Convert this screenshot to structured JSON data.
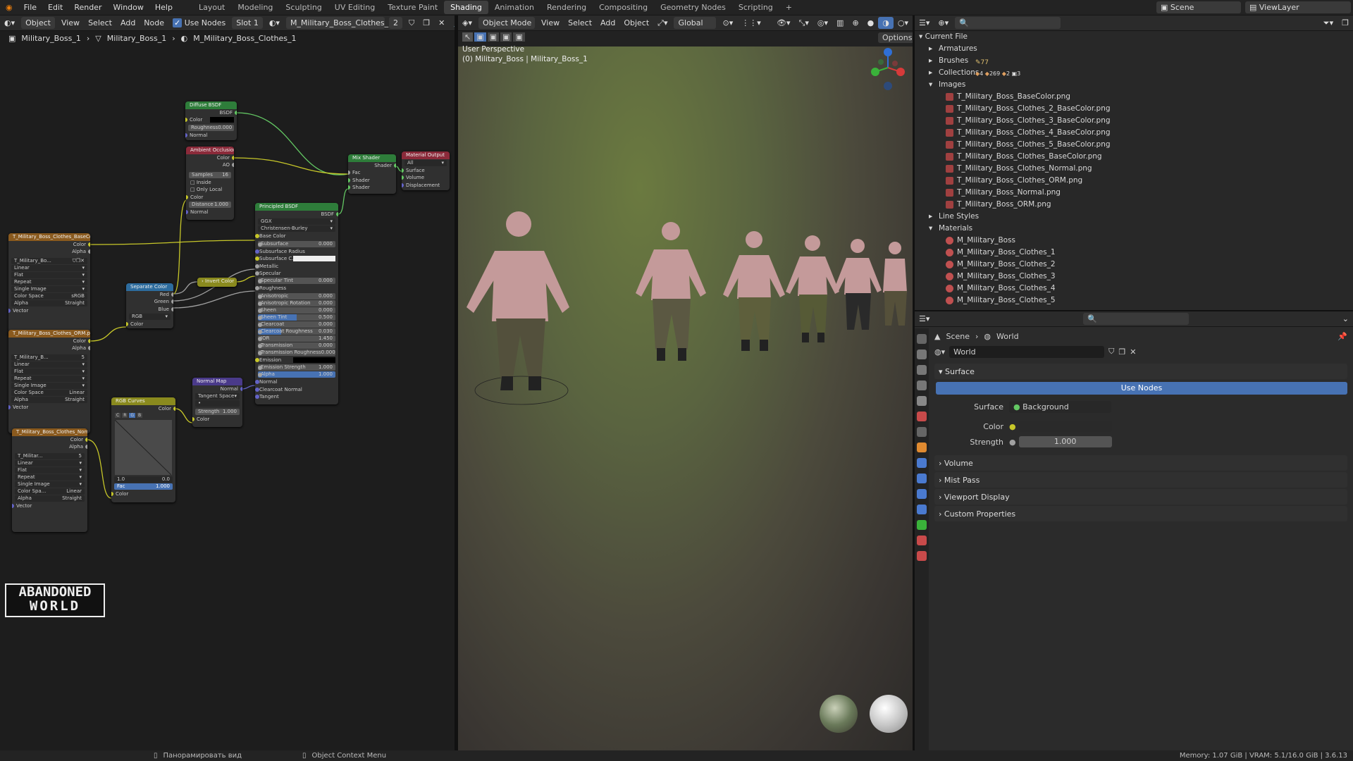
{
  "menu": {
    "items": [
      "File",
      "Edit",
      "Render",
      "Window",
      "Help"
    ]
  },
  "workspaces": [
    "Layout",
    "Modeling",
    "Sculpting",
    "UV Editing",
    "Texture Paint",
    "Shading",
    "Animation",
    "Rendering",
    "Compositing",
    "Geometry Nodes",
    "Scripting"
  ],
  "active_workspace": "Shading",
  "scene_name": "Scene",
  "view_layer": "ViewLayer",
  "node_editor": {
    "object_mode": "Object",
    "view": "View",
    "select": "Select",
    "add": "Add",
    "node": "Node",
    "use_nodes": "Use Nodes",
    "slot": "Slot 1",
    "material": "M_Military_Boss_Clothes_1",
    "users": "2",
    "breadcrumb": [
      "Military_Boss_1",
      "Military_Boss_1",
      "M_Military_Boss_Clothes_1"
    ]
  },
  "nodes": {
    "diffuse": {
      "title": "Diffuse BSDF",
      "out": "BSDF",
      "color": "Color",
      "roughness": "Roughness",
      "roughness_val": "0.000",
      "normal": "Normal"
    },
    "ao": {
      "title": "Ambient Occlusion",
      "color_out": "Color",
      "ao_out": "AO",
      "samples": "Samples",
      "samples_val": "16",
      "inside": "Inside",
      "only_local": "Only Local",
      "color": "Color",
      "distance": "Distance",
      "distance_val": "1.000",
      "normal": "Normal"
    },
    "mix": {
      "title": "Mix Shader",
      "out": "Shader",
      "fac": "Fac",
      "s1": "Shader",
      "s2": "Shader"
    },
    "output": {
      "title": "Material Output",
      "target": "All",
      "surface": "Surface",
      "volume": "Volume",
      "displacement": "Displacement"
    },
    "principled": {
      "title": "Principled BSDF",
      "out": "BSDF",
      "dist": "GGX",
      "sss": "Christensen-Burley",
      "rows": [
        [
          "Base Color",
          ""
        ],
        [
          "Subsurface",
          "0.000"
        ],
        [
          "Subsurface Radius",
          ""
        ],
        [
          "Subsurface C...",
          ""
        ],
        [
          "Metallic",
          ""
        ],
        [
          "Specular",
          ""
        ],
        [
          "Specular Tint",
          "0.000"
        ],
        [
          "Roughness",
          ""
        ],
        [
          "Anisotropic",
          "0.000"
        ],
        [
          "Anisotropic Rotation",
          "0.000"
        ],
        [
          "Sheen",
          "0.000"
        ],
        [
          "Sheen Tint",
          "0.500"
        ],
        [
          "Clearcoat",
          "0.000"
        ],
        [
          "Clearcoat Roughness",
          "0.030"
        ],
        [
          "IOR",
          "1.450"
        ],
        [
          "Transmission",
          "0.000"
        ],
        [
          "Transmission Roughness",
          "0.000"
        ],
        [
          "Emission",
          ""
        ],
        [
          "Emission Strength",
          "1.000"
        ],
        [
          "Alpha",
          "1.000"
        ],
        [
          "Normal",
          ""
        ],
        [
          "Clearcoat Normal",
          ""
        ],
        [
          "Tangent",
          ""
        ]
      ]
    },
    "tex1": {
      "title": "T_Military_Boss_Clothes_BaseColor.png",
      "color": "Color",
      "alpha": "Alpha",
      "img": "T_Military_Bo...",
      "interp": "Linear",
      "proj": "Flat",
      "ext": "Repeat",
      "src": "Single Image",
      "cs_label": "Color Space",
      "cs": "sRGB",
      "alpha_label": "Alpha",
      "alpha_mode": "Straight",
      "vector": "Vector"
    },
    "tex2": {
      "title": "T_Military_Boss_Clothes_ORM.png",
      "color": "Color",
      "alpha": "Alpha",
      "img": "T_Military_B...",
      "users": "5",
      "interp": "Linear",
      "proj": "Flat",
      "ext": "Repeat",
      "src": "Single Image",
      "cs_label": "Color Space",
      "cs": "Linear",
      "alpha_label": "Alpha",
      "alpha_mode": "Straight",
      "vector": "Vector"
    },
    "tex3": {
      "title": "T_Military_Boss_Clothes_Normal.png",
      "color": "Color",
      "alpha": "Alpha",
      "img": "T_Militar...",
      "users": "5",
      "interp": "Linear",
      "proj": "Flat",
      "ext": "Repeat",
      "src": "Single Image",
      "cs_label": "Color Spa...",
      "cs": "Linear",
      "alpha_label": "Alpha",
      "alpha_mode": "Straight",
      "vector": "Vector"
    },
    "sep": {
      "title": "Separate Color",
      "red": "Red",
      "green": "Green",
      "blue": "Blue",
      "mode": "RGB",
      "color": "Color"
    },
    "invert": {
      "title": "Invert Color"
    },
    "normalmap": {
      "title": "Normal Map",
      "out": "Normal",
      "space": "Tangent Space",
      "strength": "Strength",
      "strength_val": "1.000",
      "color": "Color"
    },
    "curves": {
      "title": "RGB Curves",
      "out": "Color",
      "fac": "Fac",
      "fac_val": "1.000",
      "color": "Color",
      "v1": "1.0",
      "v2": "0.0",
      "tabs": [
        "C",
        "R",
        "G",
        "B"
      ]
    }
  },
  "viewport": {
    "mode": "Object Mode",
    "view": "View",
    "select": "Select",
    "add": "Add",
    "object": "Object",
    "orientation": "Global",
    "options": "Options",
    "perspective": "User Perspective",
    "info": "(0) Military_Boss | Military_Boss_1"
  },
  "outliner": {
    "root": "Current File",
    "items": [
      {
        "label": "Armatures",
        "level": 1,
        "kind": "folder"
      },
      {
        "label": "Brushes",
        "level": 1,
        "kind": "folder"
      },
      {
        "label": "Collections",
        "level": 1,
        "kind": "folder"
      },
      {
        "label": "Images",
        "level": 1,
        "kind": "folder"
      },
      {
        "label": "T_Military_Boss_BaseColor.png",
        "level": 2,
        "kind": "image"
      },
      {
        "label": "T_Military_Boss_Clothes_2_BaseColor.png",
        "level": 2,
        "kind": "image"
      },
      {
        "label": "T_Military_Boss_Clothes_3_BaseColor.png",
        "level": 2,
        "kind": "image"
      },
      {
        "label": "T_Military_Boss_Clothes_4_BaseColor.png",
        "level": 2,
        "kind": "image"
      },
      {
        "label": "T_Military_Boss_Clothes_5_BaseColor.png",
        "level": 2,
        "kind": "image"
      },
      {
        "label": "T_Military_Boss_Clothes_BaseColor.png",
        "level": 2,
        "kind": "image"
      },
      {
        "label": "T_Military_Boss_Clothes_Normal.png",
        "level": 2,
        "kind": "image"
      },
      {
        "label": "T_Military_Boss_Clothes_ORM.png",
        "level": 2,
        "kind": "image"
      },
      {
        "label": "T_Military_Boss_Normal.png",
        "level": 2,
        "kind": "image"
      },
      {
        "label": "T_Military_Boss_ORM.png",
        "level": 2,
        "kind": "image"
      },
      {
        "label": "Line Styles",
        "level": 1,
        "kind": "folder"
      },
      {
        "label": "Materials",
        "level": 1,
        "kind": "folder"
      },
      {
        "label": "M_Military_Boss",
        "level": 2,
        "kind": "material"
      },
      {
        "label": "M_Military_Boss_Clothes_1",
        "level": 2,
        "kind": "material"
      },
      {
        "label": "M_Military_Boss_Clothes_2",
        "level": 2,
        "kind": "material"
      },
      {
        "label": "M_Military_Boss_Clothes_3",
        "level": 2,
        "kind": "material"
      },
      {
        "label": "M_Military_Boss_Clothes_4",
        "level": 2,
        "kind": "material"
      },
      {
        "label": "M_Military_Boss_Clothes_5",
        "level": 2,
        "kind": "material"
      }
    ],
    "counts": {
      "brushes": "77",
      "col_a": "4",
      "col_b": "269",
      "col_c": "2",
      "col_d": "3"
    }
  },
  "properties": {
    "crumb_scene": "Scene",
    "crumb_world": "World",
    "world": "World",
    "surface_panel": "Surface",
    "use_nodes": "Use Nodes",
    "surface_label": "Surface",
    "surface_value": "Background",
    "color_label": "Color",
    "strength_label": "Strength",
    "strength_value": "1.000",
    "panels": [
      "Volume",
      "Mist Pass",
      "Viewport Display",
      "Custom Properties"
    ]
  },
  "status": {
    "pan": "Панорамировать вид",
    "context": "Object Context Menu",
    "memory": "Memory: 1.07 GiB | VRAM: 5.1/16.0 GiB | 3.6.13"
  },
  "logo": {
    "line1": "ABANDONED",
    "line2": "WORLD"
  }
}
